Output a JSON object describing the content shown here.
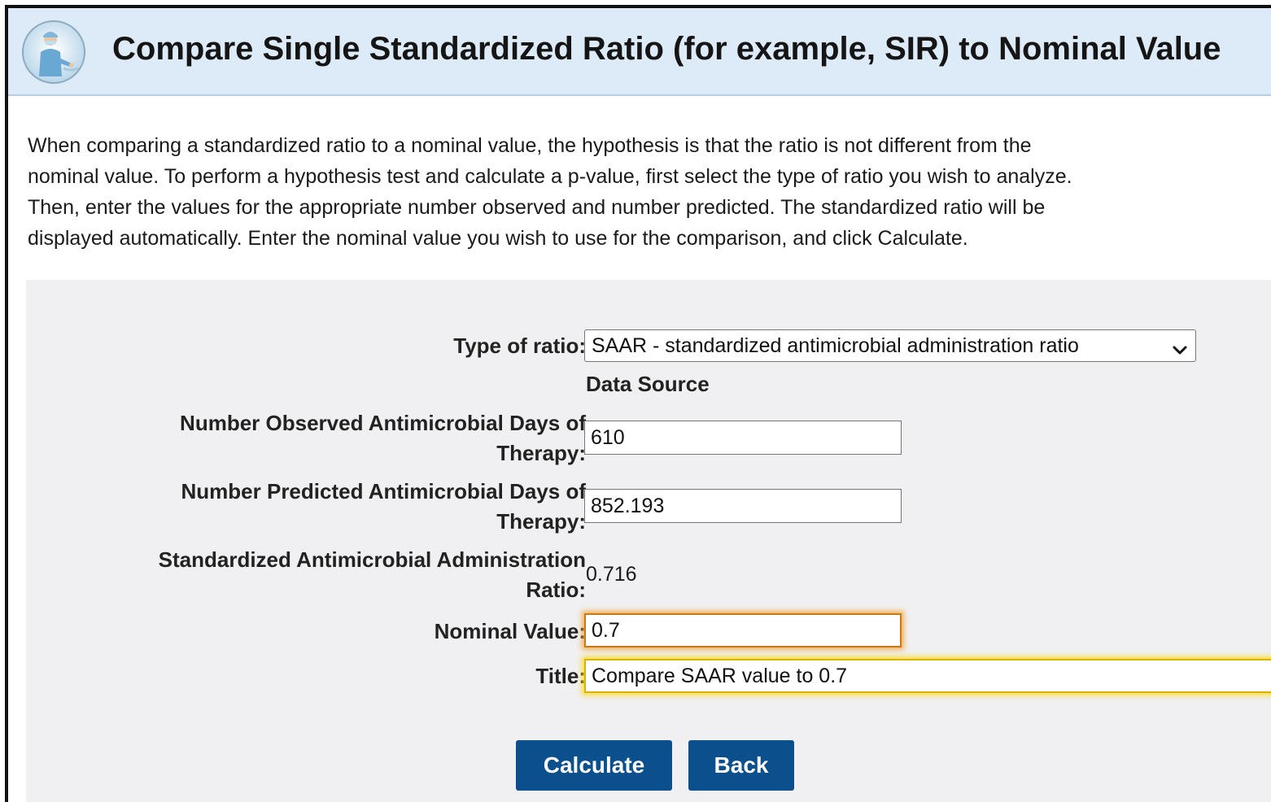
{
  "header": {
    "title": "Compare Single Standardized Ratio (for example, SIR) to Nominal Value"
  },
  "intro": {
    "lines": [
      "When comparing a standardized ratio to a nominal value, the hypothesis is that the ratio is not different from the",
      "nominal value. To perform a hypothesis test and calculate a p-value, first select the type of ratio you wish to analyze.",
      "Then, enter the values for the appropriate number observed and number predicted. The standardized ratio will be",
      "displayed automatically. Enter the nominal value you wish to use for the comparison, and click Calculate."
    ]
  },
  "form": {
    "type_of_ratio_label": "Type of ratio:",
    "type_of_ratio_value": "SAAR - standardized antimicrobial administration ratio",
    "data_source_label": "Data Source",
    "observed_label_line1": "Number Observed Antimicrobial Days of",
    "observed_label_line2": "Therapy:",
    "observed_value": "610",
    "predicted_label_line1": "Number Predicted Antimicrobial Days of",
    "predicted_label_line2": "Therapy:",
    "predicted_value": "852.193",
    "ratio_label_line1": "Standardized Antimicrobial Administration",
    "ratio_label_line2": "Ratio:",
    "ratio_value": "0.716",
    "nominal_label": "Nominal Value:",
    "nominal_value": "0.7",
    "title_label": "Title:",
    "title_value": "Compare SAAR value to 0.7"
  },
  "buttons": {
    "calculate": "Calculate",
    "back": "Back"
  },
  "colors": {
    "header_bg": "#dcebf7",
    "panel_bg": "#f0f0f2",
    "button_bg": "#0b4f8c",
    "nominal_highlight": "#f5a028",
    "title_highlight": "#ffd700"
  },
  "icons": {
    "logo": "healthcare-worker-logo-icon",
    "select_arrow": "chevron-down-icon"
  }
}
